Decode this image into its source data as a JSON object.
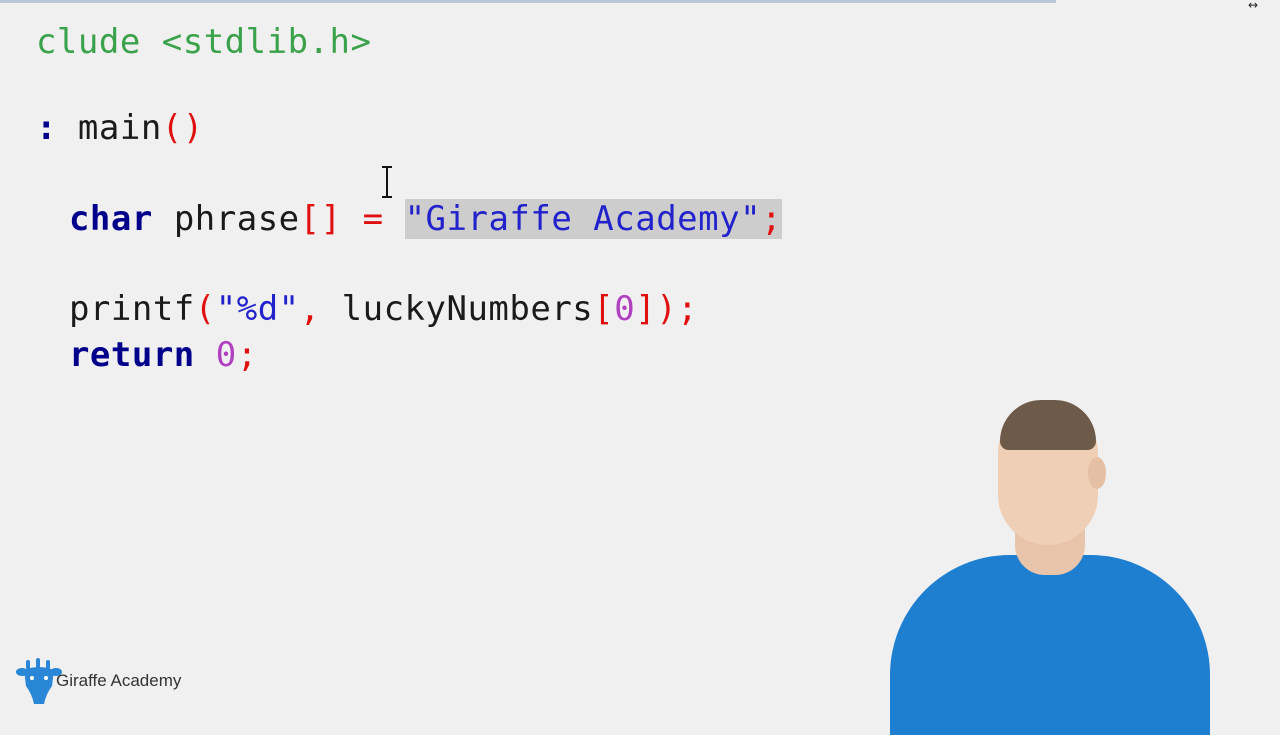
{
  "editor": {
    "include_line": "clude <stdlib.h>",
    "main_prefix": ": ",
    "main_name": "main",
    "main_parens": "()",
    "line_char": {
      "type": "char",
      "name": "phrase",
      "brackets": "[]",
      "equals": "=",
      "string": "\"Giraffe Academy\"",
      "semicolon": ";"
    },
    "line_printf": {
      "func": "printf",
      "open": "(",
      "format": "\"%d\"",
      "comma": ",",
      "arg": "luckyNumbers",
      "index_open": "[",
      "index": "0",
      "close": "]);"
    },
    "line_return": {
      "keyword": "return",
      "value": "0",
      "semicolon": ";"
    }
  },
  "window": {
    "corner_glyph": "↔"
  },
  "branding": {
    "label": "Giraffe Academy",
    "icon": "giraffe-logo-icon",
    "color": "#2a86d6"
  },
  "colors": {
    "background": "#f0f0f0",
    "keyword": "#00008b",
    "punctuation": "#e01010",
    "string": "#2222cc",
    "number": "#b040c0",
    "selection": "#cdcdcd"
  }
}
